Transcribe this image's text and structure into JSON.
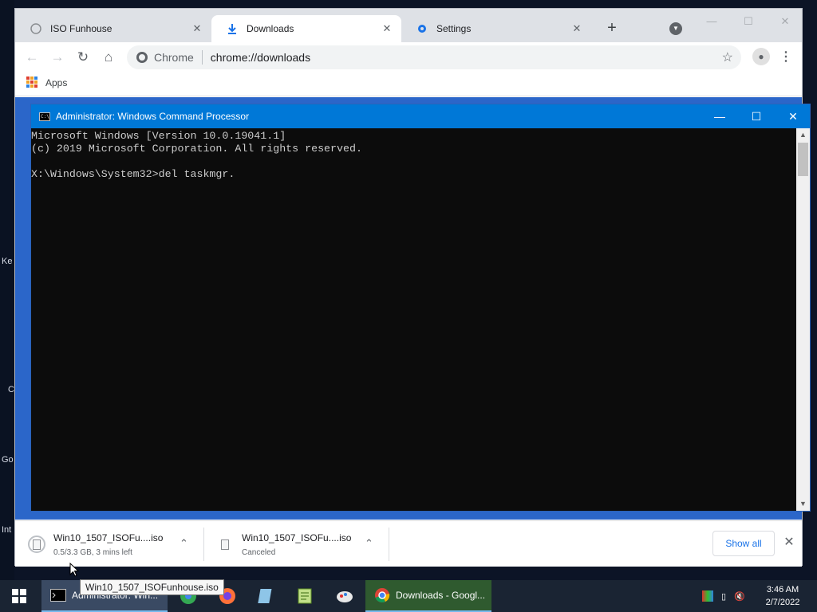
{
  "desktop": {
    "fragments": [
      "Ke",
      "C",
      "Go",
      "Int"
    ]
  },
  "browser": {
    "tabs": [
      {
        "label": "ISO Funhouse",
        "active": false
      },
      {
        "label": "Downloads",
        "active": true
      },
      {
        "label": "Settings",
        "active": false
      }
    ],
    "new_tab_symbol": "+",
    "window_controls": {
      "minimize": "—",
      "maximize": "☐",
      "close": "✕"
    },
    "address": {
      "chip": "Chrome",
      "url": "chrome://downloads"
    },
    "bookmarks": {
      "apps_label": "Apps"
    },
    "downloads": [
      {
        "name": "Win10_1507_ISOFu....iso",
        "status": "0.5/3.3 GB, 3 mins left"
      },
      {
        "name": "Win10_1507_ISOFu....iso",
        "status": "Canceled"
      }
    ],
    "show_all_label": "Show all"
  },
  "cmd": {
    "title": "Administrator: Windows Command Processor",
    "lines": [
      "Microsoft Windows [Version 10.0.19041.1]",
      "(c) 2019 Microsoft Corporation. All rights reserved.",
      "",
      "X:\\Windows\\System32>del taskmgr."
    ],
    "icon_text": "C:\\"
  },
  "tooltip": "Win10_1507_ISOFunhouse.iso",
  "taskbar": {
    "apps": [
      {
        "label": "Administrator: Win...",
        "icon": "cmd-icon"
      },
      {
        "label": "Downloads - Googl...",
        "icon": "chrome-icon"
      }
    ],
    "clock": {
      "time": "3:46 AM",
      "date": "2/7/2022"
    }
  },
  "colors": {
    "accent": "#0078d7",
    "chrome_tabstrip": "#dee1e6",
    "page_blue": "#2b66c9",
    "taskbar": "#1a2433"
  }
}
